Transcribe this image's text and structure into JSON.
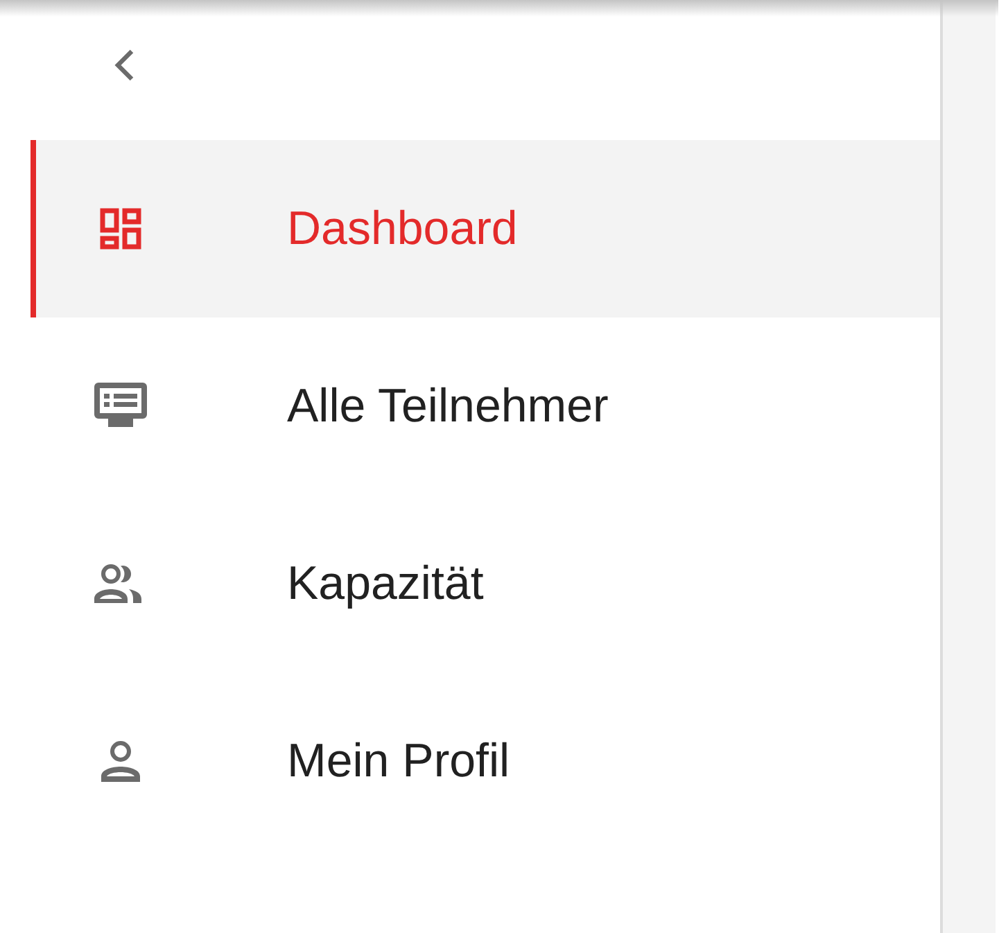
{
  "nav": {
    "items": [
      {
        "label": "Dashboard",
        "selected": true
      },
      {
        "label": "Alle Teilnehmer",
        "selected": false
      },
      {
        "label": "Kapazität",
        "selected": false
      },
      {
        "label": "Mein Profil",
        "selected": false
      }
    ]
  }
}
